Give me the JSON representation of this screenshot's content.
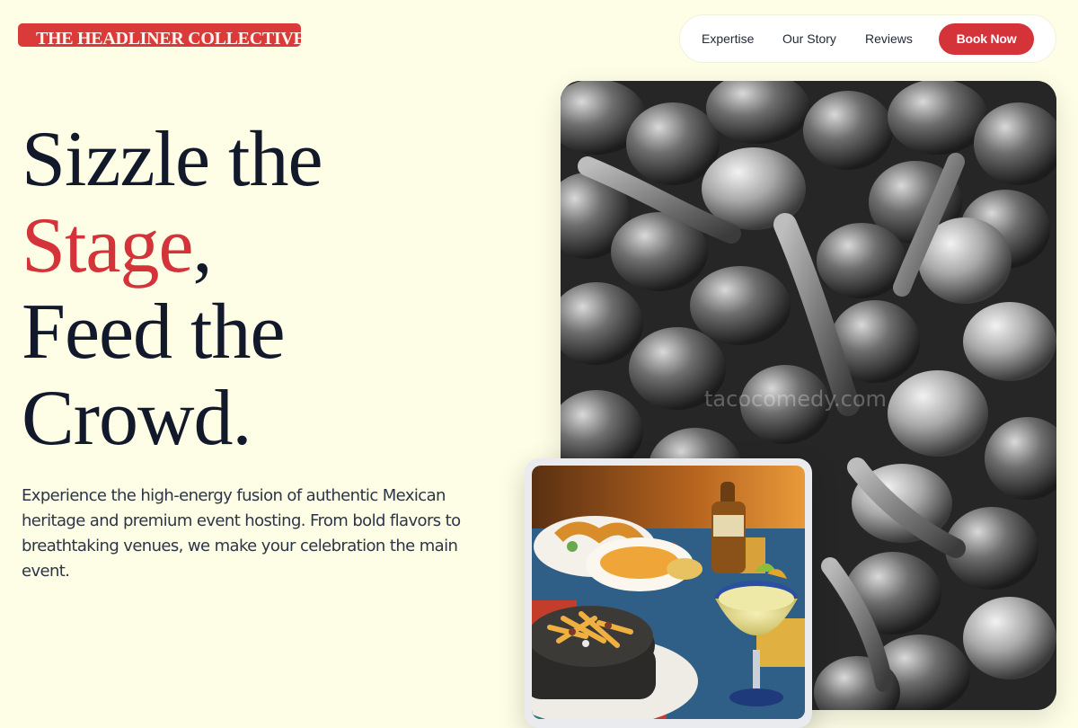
{
  "brand": {
    "name": "THE HEADLINER COLLECTIVE"
  },
  "nav": {
    "links": [
      "Expertise",
      "Our Story",
      "Reviews"
    ],
    "cta": "Book Now"
  },
  "hero": {
    "line1": "Sizzle the",
    "accent_word": "Stage",
    "accent_punct": ",",
    "line3": "Feed the",
    "line4": "Crowd.",
    "lede": "Experience the high-energy fusion of authentic Mexican heritage and premium event hosting. From bold flavors to breathtaking venues, we make your celebration the main event."
  },
  "images": {
    "main_alt": "Black and white close-up of a pile of hot peppers",
    "secondary_alt": "Mexican food spread with tacos, nachos and a margarita",
    "watermark": "tacocomedy.com"
  },
  "colors": {
    "background": "#FEFDE6",
    "accent": "#D5333A",
    "text": "#12192B"
  },
  "icons": {
    "nav_cta": "none"
  }
}
